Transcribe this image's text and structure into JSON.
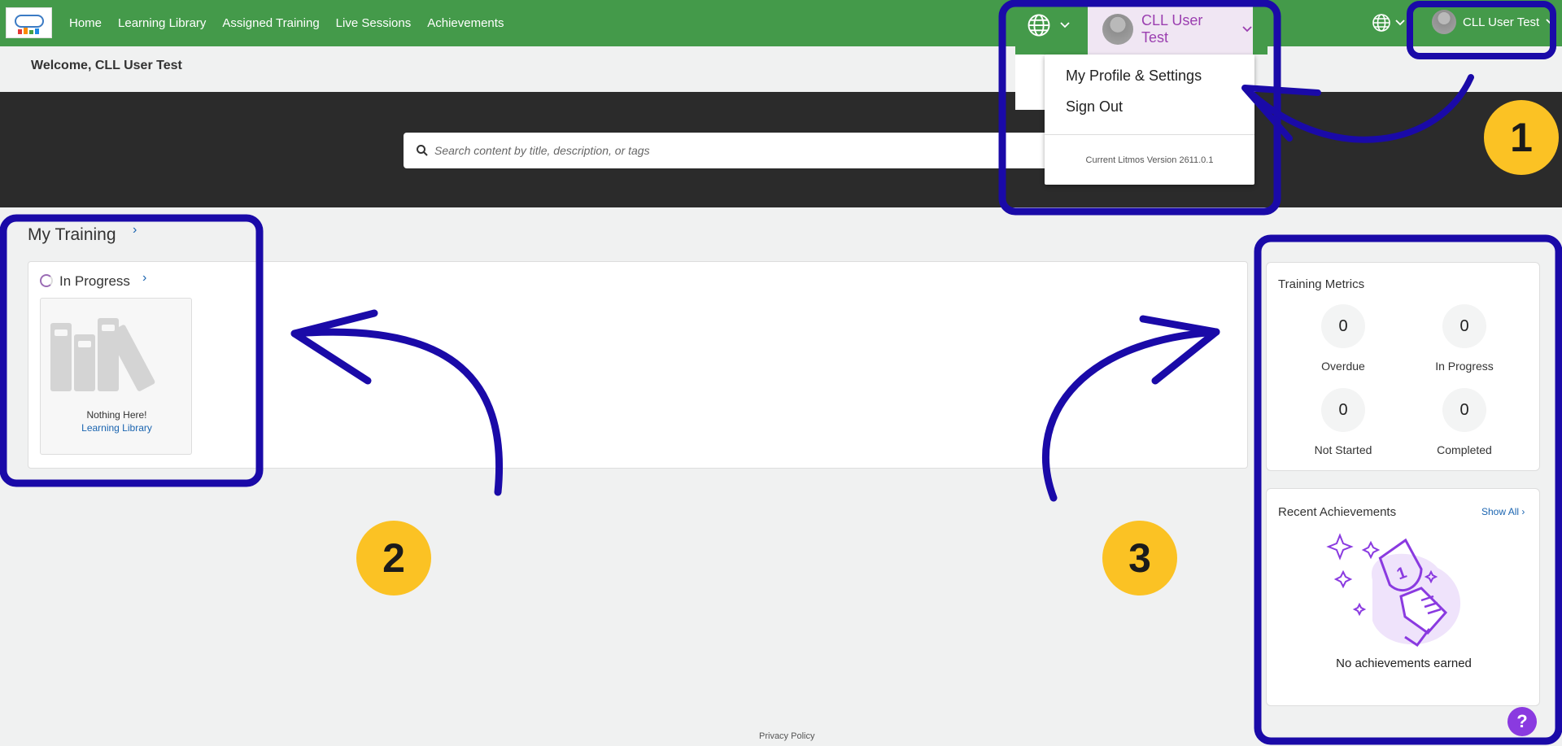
{
  "nav": {
    "links": [
      "Home",
      "Learning Library",
      "Assigned Training",
      "Live Sessions",
      "Achievements"
    ],
    "user_name": "CLL User Test"
  },
  "welcome": "Welcome, CLL User Test",
  "search": {
    "placeholder": "Search content by title, description, or tags"
  },
  "dropdown": {
    "user_name": "CLL User Test",
    "items": [
      "My Profile & Settings",
      "Sign Out"
    ],
    "version": "Current Litmos Version 2611.0.1"
  },
  "my_training": {
    "title": "My Training",
    "in_progress": "In Progress",
    "empty_text": "Nothing Here!",
    "empty_link": "Learning Library"
  },
  "metrics": {
    "title": "Training Metrics",
    "items": [
      {
        "value": "0",
        "label": "Overdue"
      },
      {
        "value": "0",
        "label": "In Progress"
      },
      {
        "value": "0",
        "label": "Not Started"
      },
      {
        "value": "0",
        "label": "Completed"
      }
    ]
  },
  "achievements": {
    "title": "Recent Achievements",
    "show_all": "Show All",
    "empty": "No achievements earned"
  },
  "footer": {
    "privacy": "Privacy Policy",
    "help": "?"
  },
  "annotations": {
    "badges": [
      "1",
      "2",
      "3"
    ],
    "color": "#1a0aa8",
    "badge_color": "#fbc224"
  },
  "colors": {
    "nav_green": "#449a4a",
    "accent_purple": "#9b3fb0",
    "link_blue": "#1a64b0",
    "dark_band": "#2b2b2b"
  }
}
